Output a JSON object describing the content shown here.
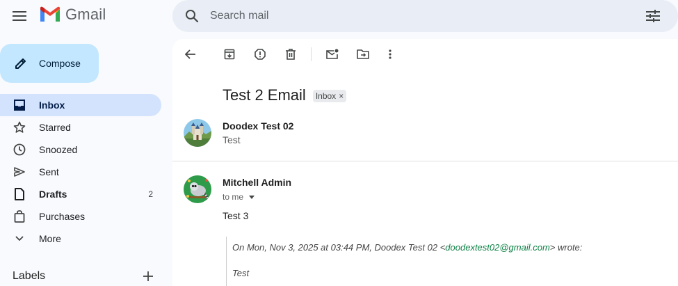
{
  "app": {
    "name": "Gmail",
    "colors": {
      "accent": "#c2e7ff",
      "active_nav": "#d3e3fd",
      "search_bg": "#e9eef6",
      "link": "#0b8043"
    }
  },
  "search": {
    "placeholder": "Search mail"
  },
  "sidebar": {
    "compose_label": "Compose",
    "items": [
      {
        "label": "Inbox",
        "icon": "inbox-icon",
        "active": true,
        "bold": true,
        "count": ""
      },
      {
        "label": "Starred",
        "icon": "star-icon",
        "active": false,
        "bold": false,
        "count": ""
      },
      {
        "label": "Snoozed",
        "icon": "clock-icon",
        "active": false,
        "bold": false,
        "count": ""
      },
      {
        "label": "Sent",
        "icon": "send-icon",
        "active": false,
        "bold": false,
        "count": ""
      },
      {
        "label": "Drafts",
        "icon": "draft-icon",
        "active": false,
        "bold": true,
        "count": "2"
      },
      {
        "label": "Purchases",
        "icon": "purchases-icon",
        "active": false,
        "bold": false,
        "count": ""
      },
      {
        "label": "More",
        "icon": "chevron-down-icon",
        "active": false,
        "bold": false,
        "count": ""
      }
    ],
    "labels_title": "Labels"
  },
  "toolbar": {
    "icons": [
      "back-arrow-icon",
      "archive-icon",
      "report-spam-icon",
      "delete-icon",
      "mark-unread-icon",
      "move-to-icon",
      "more-vert-icon"
    ]
  },
  "thread": {
    "subject": "Test 2 Email",
    "label_chip": "Inbox",
    "label_chip_close": "×",
    "messages": [
      {
        "sender": "Doodex Test 02",
        "snippet": "Test"
      },
      {
        "sender": "Mitchell Admin",
        "recipient": "to me",
        "body": "Test 3",
        "quote_prefix": "On Mon, Nov 3, 2025 at 03:44 PM, Doodex Test 02 <",
        "quote_email": "doodextest02@gmail.com",
        "quote_suffix": "> wrote:",
        "quote_body": "Test"
      }
    ]
  }
}
